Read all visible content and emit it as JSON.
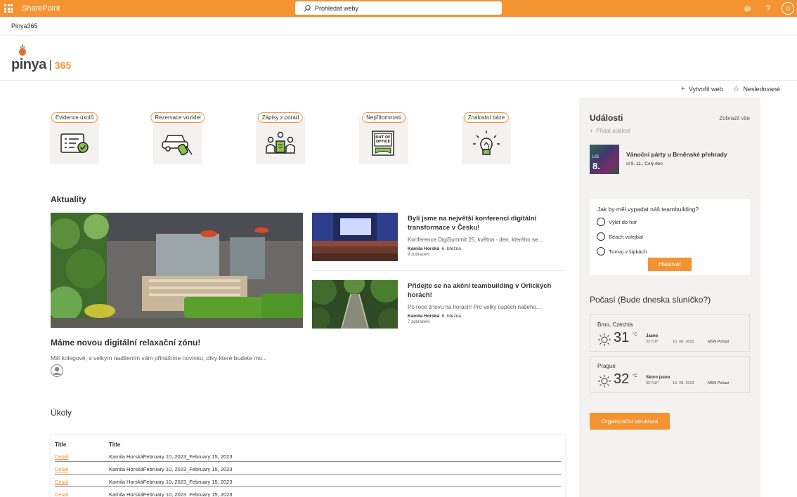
{
  "suitebar": {
    "app_name": "SharePoint",
    "search_placeholder": "Prohledat weby",
    "avatar_initial": "D",
    "help_label": "?",
    "accent": "#f39332"
  },
  "site": {
    "breadcrumb": "Pinya365"
  },
  "logo": {
    "name": "pinya",
    "separator": "|",
    "suffix": "365"
  },
  "commands": {
    "create_site": "Vytvořit web",
    "unfollow": "Nesledované"
  },
  "quicklinks": [
    {
      "label": "Evidence úkolů",
      "icon": "task-list-icon"
    },
    {
      "label": "Rezervace vozidel",
      "icon": "car-keys-icon"
    },
    {
      "label": "Zápisy z porad",
      "icon": "meeting-icon"
    },
    {
      "label": "Nepřítomnosti",
      "icon": "out-of-office-icon",
      "sign": [
        "OUT OF",
        "OFFICE"
      ]
    },
    {
      "label": "Znalostní báze",
      "icon": "lightbulb-icon"
    }
  ],
  "news": {
    "title": "Aktuality",
    "hero": {
      "title": "Máme novou digitální relaxační zónu!",
      "desc": "Milí kolegové, s velkým nadšením vám přinášíme novinku, díky které budete mo..."
    },
    "items": [
      {
        "title": "Byli jsme na největší konferenci digitální transformace v Česku!",
        "desc": "Konference DigiSummit 25. května - den, kterého se...",
        "author": "Kamila Horská",
        "date": "6. března",
        "views": "9 zobrazení"
      },
      {
        "title": "Přidejte se na akční teambuilding v Orlických horách!",
        "desc": "Po roce znovu na horách! Pro velký úspěch našeho...",
        "author": "Kamila Horská",
        "date": "6. března",
        "views": "7 zobrazení"
      }
    ]
  },
  "tasks": {
    "title": "Úkoly",
    "headers": [
      "Title",
      "Title"
    ],
    "rows": [
      {
        "link": "Detail",
        "value": "Kamila HorskáFebruary 10, 2023_February 15, 2023"
      },
      {
        "link": "Detail",
        "value": "Kamila HorskáFebruary 10, 2023_February 15, 2023"
      },
      {
        "link": "Detail",
        "value": "Kamila HorskáFebruary 10, 2023_February 15, 2023"
      },
      {
        "link": "Detail",
        "value": "Kamila HorskáFebruary 10, 2023_February 15, 2023"
      }
    ]
  },
  "events": {
    "title": "Události",
    "see_all": "Zobrazit vše",
    "add": "Přidat událost",
    "item": {
      "month": "LIS",
      "day": "8.",
      "name": "Vánoční párty u Brněnské přehrady",
      "when": "st 8. 11., Celý den"
    }
  },
  "poll": {
    "question": "Jak by měl vypadat náš teambuilding?",
    "options": [
      "Výlet do hor",
      "Beach volejbal",
      "Turnaj v šipkách"
    ],
    "vote": "Hlasovat"
  },
  "weather": {
    "title": "Počasí (Bude dneska sluníčko?)",
    "cards": [
      {
        "city": "Brno, Czechia",
        "temp": "31",
        "unit": "°C",
        "cond": "Jasno",
        "range": "32°/18°",
        "date": "15. 08. 2023",
        "source": "MSN Počasí"
      },
      {
        "city": "Prague",
        "temp": "32",
        "unit": "°C",
        "cond": "Skoro jasno",
        "range": "32°/18°",
        "date": "15. 08. 2023",
        "source": "MSN Počasí"
      }
    ]
  },
  "org_button": "Organizační struktura"
}
